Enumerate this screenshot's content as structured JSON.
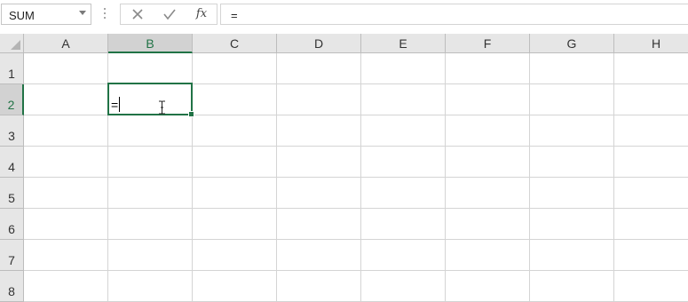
{
  "name_box": {
    "value": "SUM"
  },
  "formula_bar": {
    "cancel_icon": "close-icon",
    "enter_icon": "check-icon",
    "function_label": "fx",
    "value": "="
  },
  "columns": [
    "A",
    "B",
    "C",
    "D",
    "E",
    "F",
    "G",
    "H"
  ],
  "rows": [
    "1",
    "2",
    "3",
    "4",
    "5",
    "6",
    "7",
    "8"
  ],
  "selected_column": "B",
  "selected_row": "2",
  "active_cell": {
    "ref": "B2",
    "content": "="
  },
  "colors": {
    "accent": "#217346",
    "header_bg": "#e6e6e6",
    "gridline": "#d4d4d4"
  }
}
